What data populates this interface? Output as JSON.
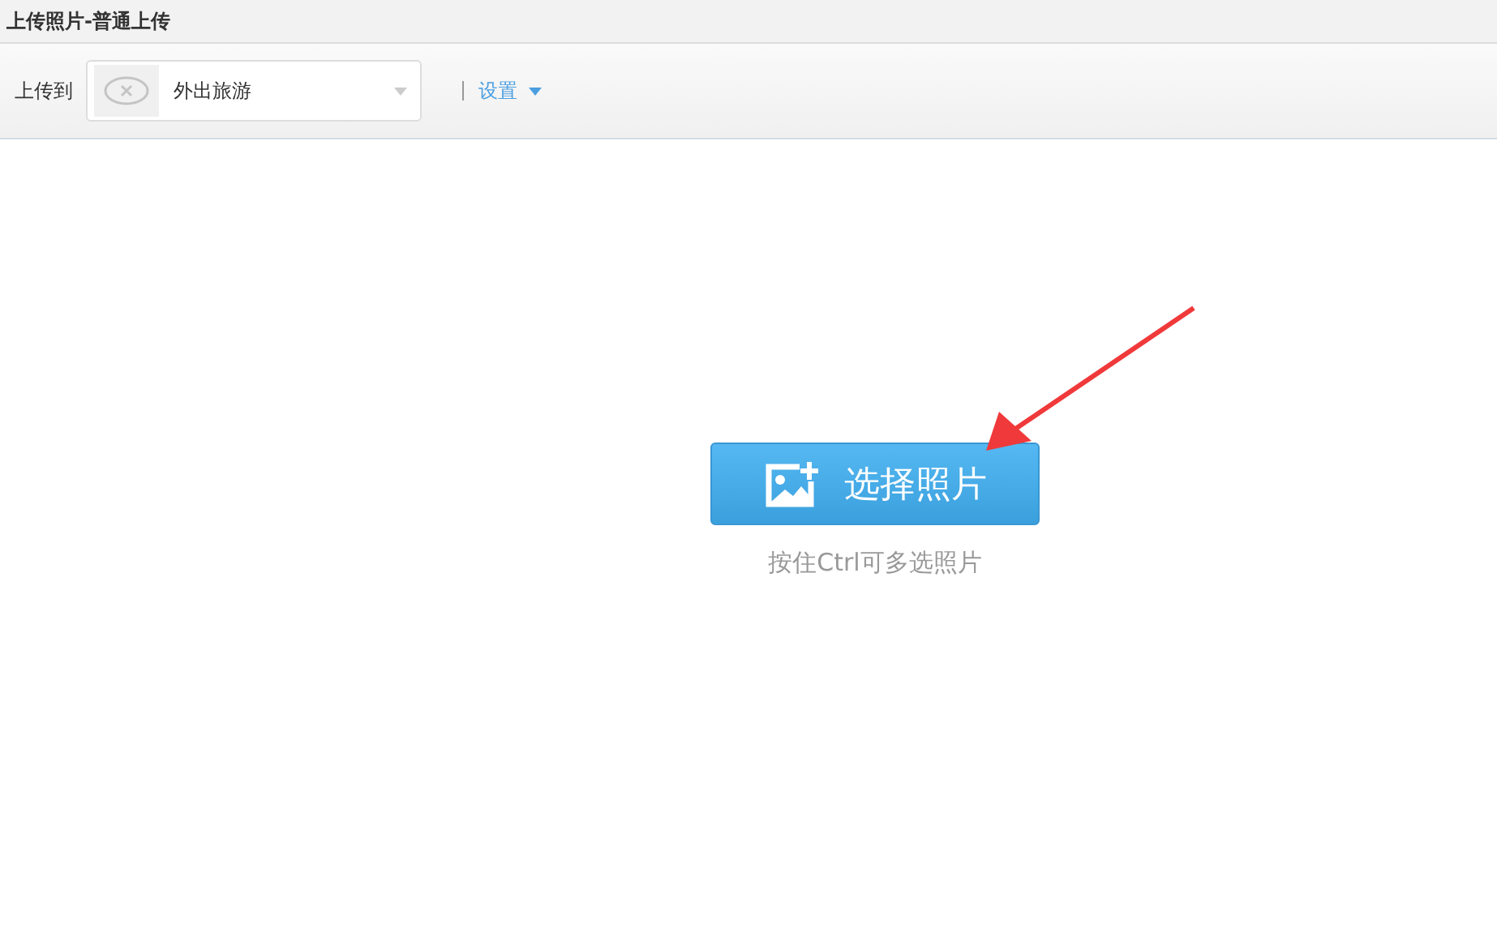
{
  "window": {
    "title": "上传照片-普通上传"
  },
  "toolbar": {
    "upload_to_label": "上传到",
    "album": {
      "name": "外出旅游"
    },
    "settings": {
      "label": "设置"
    }
  },
  "main": {
    "choose_button": {
      "label": "选择照片"
    },
    "hint": "按住Ctrl可多选照片"
  }
}
